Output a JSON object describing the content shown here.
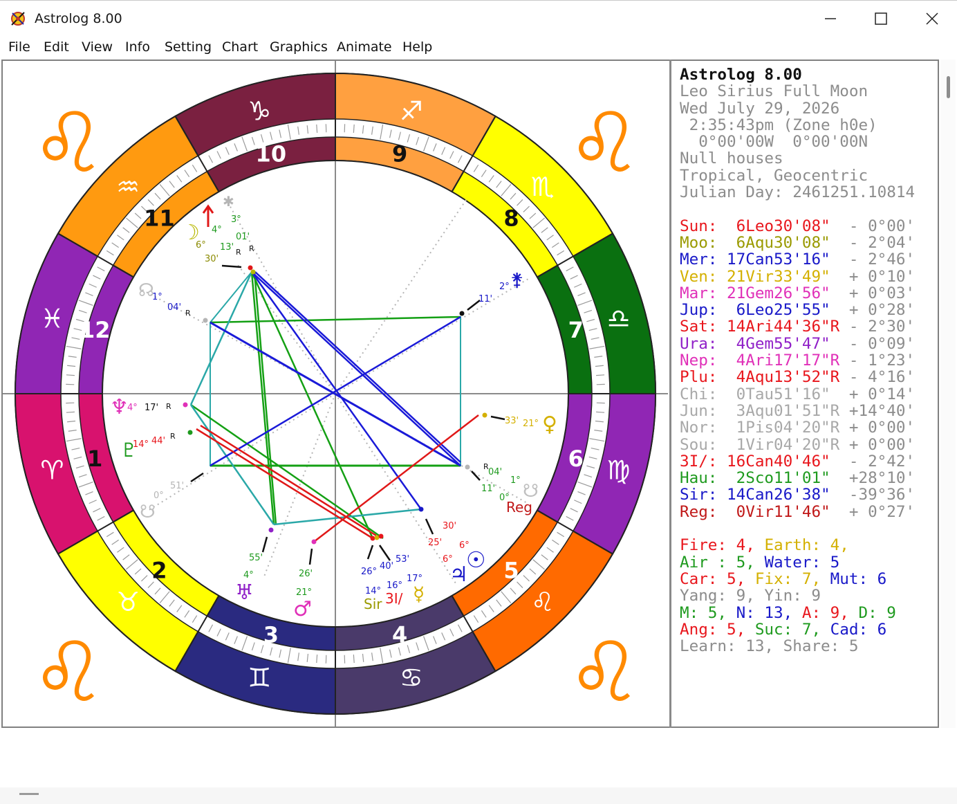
{
  "window": {
    "title": "Astrolog 8.00",
    "controls": {
      "minimize": "minimize-icon",
      "maximize": "maximize-icon",
      "close": "close-icon"
    }
  },
  "menu": {
    "items": [
      {
        "label": "File"
      },
      {
        "label": "Edit"
      },
      {
        "label": "View"
      },
      {
        "label": "Info"
      },
      {
        "label": "Setting"
      },
      {
        "label": "Chart"
      },
      {
        "label": "Graphics"
      },
      {
        "label": "Animate"
      },
      {
        "label": "Help"
      }
    ]
  },
  "chart": {
    "corner_glyph": "♌",
    "houses": [
      "1",
      "2",
      "3",
      "4",
      "5",
      "6",
      "7",
      "8",
      "9",
      "10",
      "11",
      "12"
    ],
    "signs": {
      "aries": "♈",
      "taurus": "♉",
      "gemini": "♊",
      "cancer": "♋",
      "leo": "♌",
      "virgo": "♍",
      "libra": "♎",
      "scorpio": "♏",
      "sagittarius": "♐",
      "capricorn": "♑",
      "aquarius": "♒",
      "pisces": "♓"
    },
    "planet_labels": {
      "moon": {
        "glyph": "☽",
        "deg": "6°",
        "min": "30'"
      },
      "mars_arrow": {
        "deg": "4°",
        "min": "13'",
        "retro": "R"
      },
      "chiron_top": {
        "deg": "3°",
        "min": "01'",
        "retro": "R"
      },
      "sat_left": {
        "deg": "1°",
        "min": "04'",
        "retro": "R"
      },
      "nep_left": {
        "glyph": "♆",
        "deg": "4°",
        "min": "17'",
        "retro": "R"
      },
      "plu_left": {
        "deg": "14°",
        "min": "44'",
        "retro": "R"
      },
      "south_node": {
        "deg": "0°",
        "min": "51'"
      },
      "uranus": {
        "glyph": "♅",
        "deg": "4°",
        "min": "55'"
      },
      "mars": {
        "glyph": "♂",
        "deg": "21°",
        "min": "26'"
      },
      "cluster": {
        "a": "26°",
        "b": "40'",
        "c": "53'",
        "d": "14°",
        "e": "16°",
        "f": "17°",
        "sir": "Sir",
        "hyp": "3I/"
      },
      "jupiter": {
        "glyph": "♃",
        "deg": "6°",
        "min": "25'"
      },
      "sun": {
        "glyph": "☉",
        "deg": "6°",
        "min": "30'"
      },
      "venus": {
        "glyph": "♀",
        "deg": "21°",
        "min": "33'"
      },
      "reg": {
        "label": "Reg",
        "deg": "0°",
        "min": "11'",
        "d2": "1°",
        "m2": "04'",
        "retro": "R"
      },
      "juno": {
        "deg": "2°",
        "min": "11'"
      }
    }
  },
  "info_panel": {
    "header": [
      "Astrolog 8.00",
      "Leo Sirius Full Moon",
      "Wed July 29, 2026",
      " 2:35:43pm (Zone h0e)",
      "  0°00'00W  0°00'00N",
      "Null houses",
      "Tropical, Geocentric",
      "Julian Day: 2461251.10814"
    ],
    "planets": [
      {
        "name": "Sun:",
        "pos": " 6Leo30'08\" ",
        "vel": " - 0°00'",
        "color": "#e8161c"
      },
      {
        "name": "Moo:",
        "pos": " 6Aqu30'08\" ",
        "vel": " - 2°04'",
        "color": "#9a9a00"
      },
      {
        "name": "Mer:",
        "pos": "17Can53'16\" ",
        "vel": " - 2°46'",
        "color": "#1818c8"
      },
      {
        "name": "Ven:",
        "pos": "21Vir33'49\" ",
        "vel": " + 0°10'",
        "color": "#d4b000"
      },
      {
        "name": "Mar:",
        "pos": "21Gem26'56\" ",
        "vel": " + 0°03'",
        "color": "#e030b8"
      },
      {
        "name": "Jup:",
        "pos": " 6Leo25'55\" ",
        "vel": " + 0°28'",
        "color": "#1818c8"
      },
      {
        "name": "Sat:",
        "pos": "14Ari44'36\"R",
        "vel": " - 2°30'",
        "color": "#e8161c"
      },
      {
        "name": "Ura:",
        "pos": " 4Gem55'47\" ",
        "vel": " - 0°09'",
        "color": "#9020c8"
      },
      {
        "name": "Nep:",
        "pos": " 4Ari17'17\"R",
        "vel": " - 1°23'",
        "color": "#e030b8"
      },
      {
        "name": "Plu:",
        "pos": " 4Aqu13'52\"R",
        "vel": " - 4°16'",
        "color": "#e8161c"
      },
      {
        "name": "Chi:",
        "pos": " 0Tau51'16\" ",
        "vel": " + 0°14'",
        "color": "#a8a8a8"
      },
      {
        "name": "Jun:",
        "pos": " 3Aqu01'51\"R",
        "vel": " +14°40'",
        "color": "#a8a8a8"
      },
      {
        "name": "Nor:",
        "pos": " 1Pis04'20\"R",
        "vel": " + 0°00'",
        "color": "#a8a8a8"
      },
      {
        "name": "Sou:",
        "pos": " 1Vir04'20\"R",
        "vel": " + 0°00'",
        "color": "#a8a8a8"
      },
      {
        "name": "3I/:",
        "pos": "16Can40'46\" ",
        "vel": " - 2°42'",
        "color": "#e8161c"
      },
      {
        "name": "Hau:",
        "pos": " 2Sco11'01\" ",
        "vel": " +28°10'",
        "color": "#1e9a1e"
      },
      {
        "name": "Sir:",
        "pos": "14Can26'38\" ",
        "vel": " -39°36'",
        "color": "#1818c8"
      },
      {
        "name": "Reg:",
        "pos": " 0Vir11'46\" ",
        "vel": " + 0°27'",
        "color": "#c01818"
      }
    ],
    "summary": [
      [
        {
          "t": "Fire: 4, ",
          "c": "#e8161c"
        },
        {
          "t": "Earth: 4,",
          "c": "#d4b000"
        }
      ],
      [
        {
          "t": "Air : 5, ",
          "c": "#1e9a1e"
        },
        {
          "t": "Water: 5",
          "c": "#1818c8"
        }
      ],
      [
        {
          "t": "Car: 5, ",
          "c": "#e8161c"
        },
        {
          "t": "Fix: 7, ",
          "c": "#d4b000"
        },
        {
          "t": "Mut: 6",
          "c": "#1818c8"
        }
      ],
      [
        {
          "t": "Yang: 9, Yin: 9",
          "c": "#8c8c8c"
        }
      ],
      [
        {
          "t": "M: 5, ",
          "c": "#1e9a1e"
        },
        {
          "t": "N: 13, ",
          "c": "#1818c8"
        },
        {
          "t": "A: 9, ",
          "c": "#e8161c"
        },
        {
          "t": "D: 9",
          "c": "#1e9a1e"
        }
      ],
      [
        {
          "t": "Ang: 5, ",
          "c": "#e8161c"
        },
        {
          "t": "Suc: 7, ",
          "c": "#1e9a1e"
        },
        {
          "t": "Cad: 6",
          "c": "#1818c8"
        }
      ],
      [
        {
          "t": "Learn: 13, Share: 5",
          "c": "#8c8c8c"
        }
      ]
    ]
  }
}
